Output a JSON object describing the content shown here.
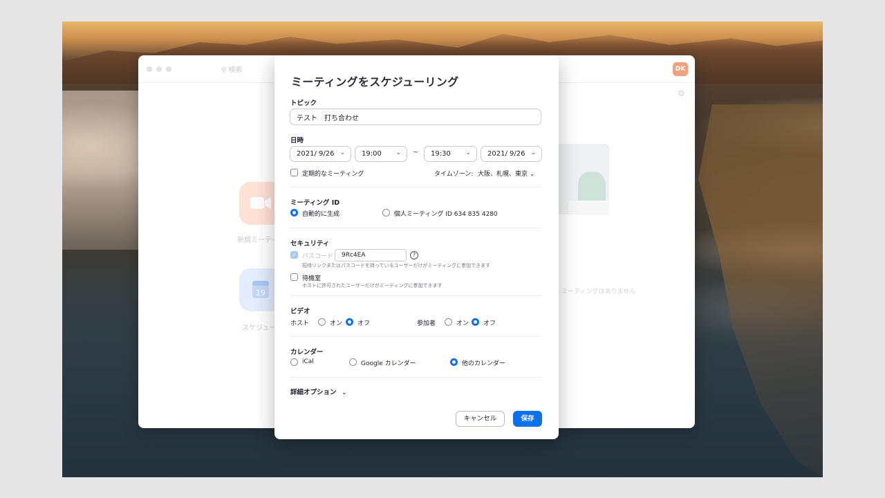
{
  "background_window": {
    "search_placeholder": "検索",
    "avatar_initials": "DK",
    "tiles": [
      {
        "label": "新規ミーティ",
        "icon": "video-camera-icon",
        "color": "#ffe1d6"
      },
      {
        "label": "スケジュー",
        "icon": "calendar-icon",
        "color": "#e3edfd",
        "calendar_day": "19"
      }
    ],
    "empty_message": "ミーティングはありません"
  },
  "dialog": {
    "title": "ミーティングをスケジューリング",
    "topic": {
      "label": "トピック",
      "value": "テスト　打ち合わせ"
    },
    "datetime": {
      "label": "日時",
      "start_date": "2021/ 9/26",
      "start_time": "19:00",
      "separator": "~",
      "end_time": "19:30",
      "end_date": "2021/ 9/26",
      "recurring_label": "定期的なミーティング",
      "timezone_label": "タイムゾーン:",
      "timezone_value": "大阪、札幌、東京"
    },
    "meeting_id": {
      "label": "ミーティング ID",
      "auto_label": "自動的に生成",
      "personal_label": "個人ミーティング ID 634 835 4280"
    },
    "security": {
      "label": "セキュリティ",
      "passcode_label": "パスコード",
      "passcode_value": "9Rc4EA",
      "help_symbol": "?",
      "passcode_note": "招待リンクまたはパスコードを持っているユーザーだけがミーティングに参加できます",
      "waiting_room_label": "待機室",
      "waiting_room_note": "ホストに許可されたユーザーだけがミーティングに参加できます"
    },
    "video": {
      "label": "ビデオ",
      "host_label": "ホスト",
      "participants_label": "参加者",
      "on_label": "オン",
      "off_label": "オフ"
    },
    "calendar": {
      "label": "カレンダー",
      "options": [
        "iCal",
        "Google カレンダー",
        "他のカレンダー"
      ],
      "selected": "他のカレンダー"
    },
    "advanced": {
      "label": "詳細オプション",
      "chevron": "⌄"
    },
    "buttons": {
      "cancel": "キャンセル",
      "save": "保存"
    }
  },
  "colors": {
    "accent": "#0e71eb",
    "text": "#232333"
  }
}
